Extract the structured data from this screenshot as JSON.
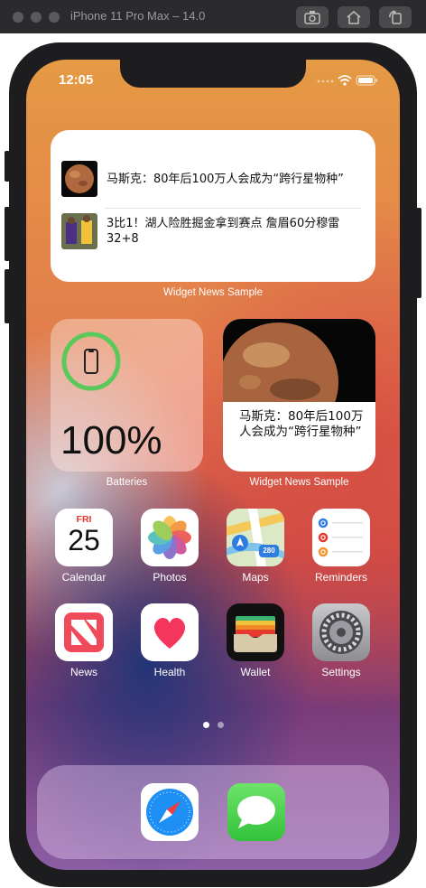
{
  "simulator": {
    "title": "iPhone 11 Pro Max – 14.0",
    "buttons": [
      "screenshot-icon",
      "home-icon",
      "rotate-icon"
    ]
  },
  "status_bar": {
    "time": "12:05"
  },
  "widgets": {
    "news_medium": {
      "items": [
        {
          "title": "马斯克：80年后100万人会成为“跨行星物种”"
        },
        {
          "title": "3比1！湖人险胜掘金拿到赛点 詹眉60分穆雷32+8"
        }
      ],
      "label": "Widget News Sample"
    },
    "batteries": {
      "percent": "100%",
      "label": "Batteries",
      "level": 1.0
    },
    "news_small": {
      "title": "马斯克：80年后100万人会成为“跨行星物种”",
      "label": "Widget News Sample"
    }
  },
  "apps": [
    {
      "name": "Calendar",
      "weekday": "FRI",
      "day": "25"
    },
    {
      "name": "Photos"
    },
    {
      "name": "Maps",
      "badge": "280"
    },
    {
      "name": "Reminders"
    },
    {
      "name": "News"
    },
    {
      "name": "Health"
    },
    {
      "name": "Wallet"
    },
    {
      "name": "Settings"
    }
  ],
  "dock": [
    "Safari",
    "Messages"
  ],
  "colors": {
    "accent_green": "#5bc85a",
    "battery_ring": "#5bc85a"
  }
}
